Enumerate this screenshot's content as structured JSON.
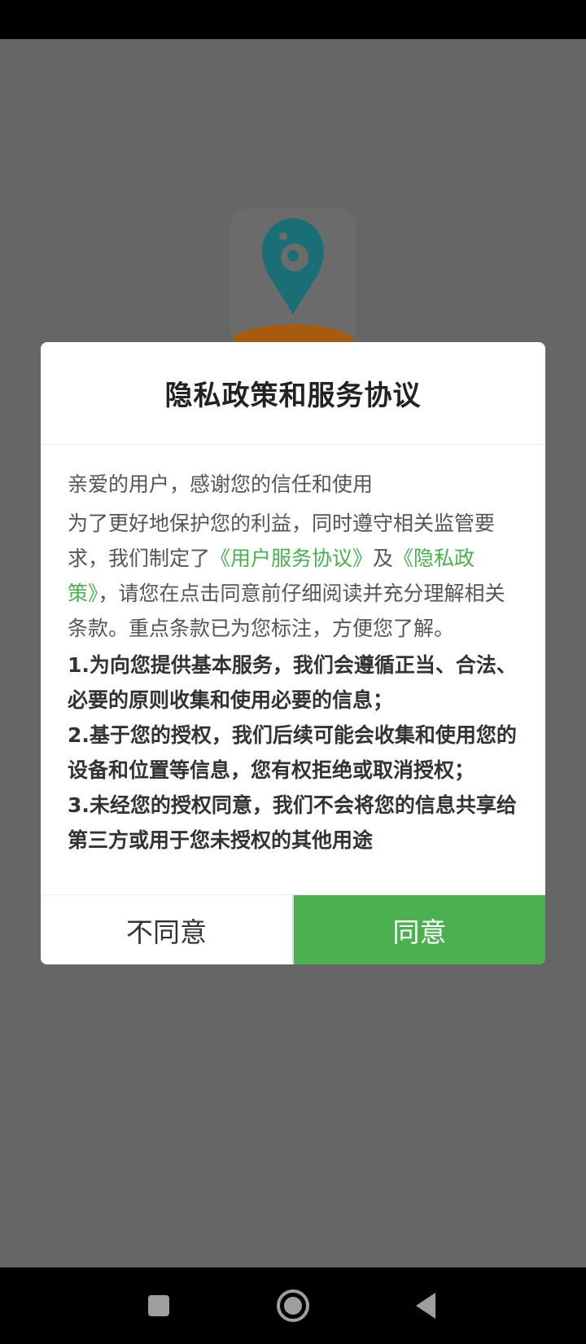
{
  "dialog": {
    "title": "隐私政策和服务协议",
    "greeting": "亲爱的用户，感谢您的信任和使用",
    "intro_part1": "为了更好地保护您的利益，同时遵守相关监管要求，我们制定了",
    "link_user_agreement": "《用户服务协议》",
    "intro_and": "及",
    "link_privacy_policy": "《隐私政策》",
    "intro_part2": "，请您在点击同意前仔细阅读并充分理解相关条款。重点条款已为您标注，方便您了解。",
    "terms": [
      "1.为向您提供基本服务，我们会遵循正当、合法、必要的原则收集和使用必要的信息；",
      "2.基于您的授权，我们后续可能会收集和使用您的设备和位置等信息，您有权拒绝或取消授权；",
      "3.未经您的授权同意，我们不会将您的信息共享给第三方或用于您未授权的其他用途"
    ],
    "disagree_label": "不同意",
    "agree_label": "同意"
  },
  "icons": {
    "app_logo": "app-logo-icon",
    "nav_recents": "square-icon",
    "nav_home": "circle-icon",
    "nav_back": "triangle-back-icon"
  },
  "colors": {
    "accent": "#4caf50",
    "overlay": "#666666",
    "logo_teal": "#1a7d86",
    "logo_orange": "#c06a10"
  }
}
